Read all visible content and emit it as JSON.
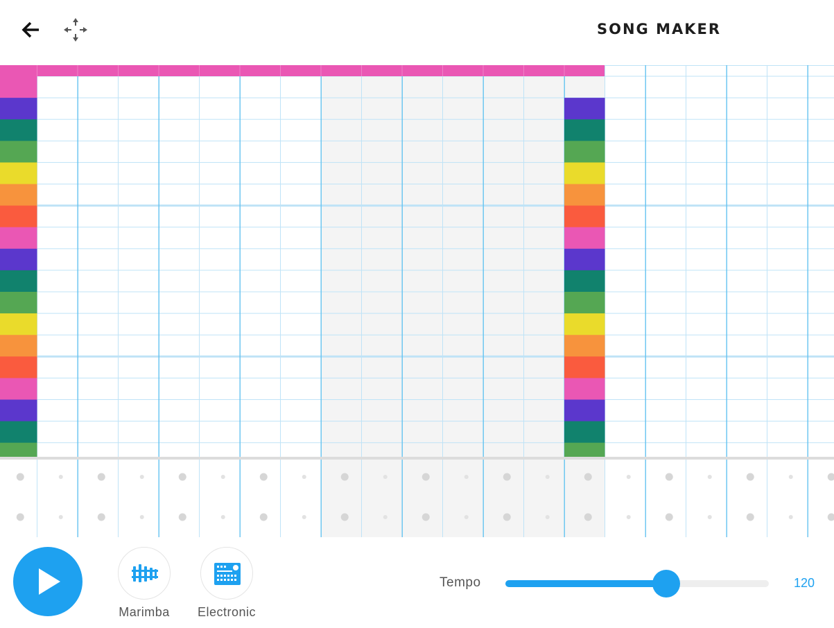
{
  "app": {
    "title": "SONG MAKER",
    "icons": {
      "back": "arrow-left-icon",
      "move": "move-arrows-icon",
      "play": "play-icon"
    }
  },
  "grid": {
    "columns": 21,
    "melody_rows": 18,
    "percussion_rows": 2,
    "shaded_measure_columns": [
      8,
      9,
      10,
      11,
      12,
      13,
      14
    ],
    "notes": [
      {
        "col": 0,
        "row": 0,
        "color": "#ea57b4"
      },
      {
        "col": 0,
        "row": 1,
        "color": "#5b37cc"
      },
      {
        "col": 0,
        "row": 2,
        "color": "#11826d"
      },
      {
        "col": 0,
        "row": 3,
        "color": "#55a753"
      },
      {
        "col": 0,
        "row": 4,
        "color": "#eadb2b"
      },
      {
        "col": 0,
        "row": 5,
        "color": "#f7933d"
      },
      {
        "col": 0,
        "row": 6,
        "color": "#fa5b3e"
      },
      {
        "col": 0,
        "row": 7,
        "color": "#ea57b4"
      },
      {
        "col": 0,
        "row": 8,
        "color": "#5b37cc"
      },
      {
        "col": 0,
        "row": 9,
        "color": "#11826d"
      },
      {
        "col": 0,
        "row": 10,
        "color": "#55a753"
      },
      {
        "col": 0,
        "row": 11,
        "color": "#eadb2b"
      },
      {
        "col": 0,
        "row": 12,
        "color": "#f7933d"
      },
      {
        "col": 0,
        "row": 13,
        "color": "#fa5b3e"
      },
      {
        "col": 0,
        "row": 14,
        "color": "#ea57b4"
      },
      {
        "col": 0,
        "row": 15,
        "color": "#5b37cc"
      },
      {
        "col": 0,
        "row": 16,
        "color": "#11826d"
      },
      {
        "col": 0,
        "row": 17,
        "color": "#55a753"
      },
      {
        "col": 14,
        "row": 1,
        "color": "#5b37cc"
      },
      {
        "col": 14,
        "row": 2,
        "color": "#11826d"
      },
      {
        "col": 14,
        "row": 3,
        "color": "#55a753"
      },
      {
        "col": 14,
        "row": 4,
        "color": "#eadb2b"
      },
      {
        "col": 14,
        "row": 5,
        "color": "#f7933d"
      },
      {
        "col": 14,
        "row": 6,
        "color": "#fa5b3e"
      },
      {
        "col": 14,
        "row": 7,
        "color": "#ea57b4"
      },
      {
        "col": 14,
        "row": 8,
        "color": "#5b37cc"
      },
      {
        "col": 14,
        "row": 9,
        "color": "#11826d"
      },
      {
        "col": 14,
        "row": 10,
        "color": "#55a753"
      },
      {
        "col": 14,
        "row": 11,
        "color": "#eadb2b"
      },
      {
        "col": 14,
        "row": 12,
        "color": "#f7933d"
      },
      {
        "col": 14,
        "row": 13,
        "color": "#fa5b3e"
      },
      {
        "col": 14,
        "row": 14,
        "color": "#ea57b4"
      },
      {
        "col": 14,
        "row": 15,
        "color": "#5b37cc"
      },
      {
        "col": 14,
        "row": 16,
        "color": "#11826d"
      },
      {
        "col": 14,
        "row": 17,
        "color": "#55a753"
      }
    ],
    "top_row_cols": [
      1,
      13
    ],
    "top_row_color": "#ea57b4",
    "bottom_row_cols": [
      0,
      14
    ],
    "bottom_row_color": "#eadb2b"
  },
  "instruments": [
    {
      "id": "marimba",
      "label": "Marimba",
      "icon": "marimba-icon"
    },
    {
      "id": "electronic",
      "label": "Electronic",
      "icon": "drum-machine-icon"
    }
  ],
  "tempo": {
    "label": "Tempo",
    "value": "120",
    "level": 0.61
  },
  "colors": {
    "accent": "#1ea1f0",
    "grid_line": "#bfe3f7",
    "grid_line_strong": "#64c3f0",
    "shade": "#f4f4f4",
    "dot_big": "#d6d6d6",
    "dot_small": "#e2e2e2"
  }
}
